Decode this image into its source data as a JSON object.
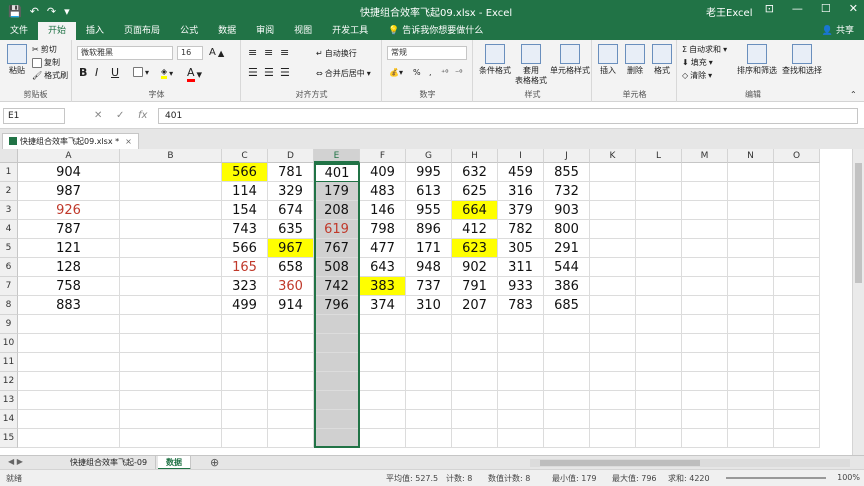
{
  "titlebar": {
    "doc_title": "快捷组合效率飞起09.xlsx  -  Excel",
    "user": "老王Excel",
    "win_min": "—",
    "win_max": "☐",
    "win_close": "✕",
    "restore": "⊡"
  },
  "tabs": {
    "items": [
      "文件",
      "开始",
      "插入",
      "页面布局",
      "公式",
      "数据",
      "审阅",
      "视图",
      "开发工具"
    ],
    "active": "开始",
    "tell_me": "告诉我你想要做什么",
    "share": "共享"
  },
  "ribbon": {
    "clipboard": {
      "label": "剪贴板",
      "paste": "粘贴",
      "cut": "剪切",
      "copy": "复制",
      "format_painter": "格式刷"
    },
    "font": {
      "label": "字体",
      "font_name": "微软雅黑",
      "font_size": "16",
      "bold": "B",
      "italic": "I",
      "underline": "U"
    },
    "alignment": {
      "label": "对齐方式",
      "wrap": "自动换行",
      "merge": "合并后居中"
    },
    "number": {
      "label": "数字",
      "format": "常规"
    },
    "styles": {
      "label": "样式",
      "conditional": "条件格式",
      "table": "套用\n表格格式",
      "cell_styles": "单元格样式"
    },
    "cells": {
      "label": "单元格",
      "insert": "插入",
      "delete": "删除",
      "format": "格式"
    },
    "editing": {
      "label": "编辑",
      "autosum": "自动求和",
      "fill": "填充",
      "clear": "清除",
      "sort": "排序和筛选",
      "find": "查找和选择"
    }
  },
  "formula_bar": {
    "name_box": "E1",
    "cancel": "✕",
    "enter": "✓",
    "fx": "fx",
    "value": "401"
  },
  "workbook_tab": {
    "name": "快捷组合效率飞起09.xlsx *",
    "close": "×"
  },
  "grid": {
    "columns": [
      "A",
      "B",
      "C",
      "D",
      "E",
      "F",
      "G",
      "H",
      "I",
      "J",
      "K",
      "L",
      "M",
      "N",
      "O"
    ],
    "rows": [
      "1",
      "2",
      "3",
      "4",
      "5",
      "6",
      "7",
      "8",
      "9",
      "10",
      "11",
      "12",
      "13",
      "14",
      "15"
    ],
    "selected_column": "E",
    "data": [
      [
        "904",
        "",
        "566",
        "781",
        "401",
        "409",
        "995",
        "632",
        "459",
        "855"
      ],
      [
        "987",
        "",
        "114",
        "329",
        "179",
        "483",
        "613",
        "625",
        "316",
        "732"
      ],
      [
        "926",
        "",
        "154",
        "674",
        "208",
        "146",
        "955",
        "664",
        "379",
        "903"
      ],
      [
        "787",
        "",
        "743",
        "635",
        "619",
        "798",
        "896",
        "412",
        "782",
        "800"
      ],
      [
        "121",
        "",
        "566",
        "967",
        "767",
        "477",
        "171",
        "623",
        "305",
        "291"
      ],
      [
        "128",
        "",
        "165",
        "658",
        "508",
        "643",
        "948",
        "902",
        "311",
        "544"
      ],
      [
        "758",
        "",
        "323",
        "360",
        "742",
        "383",
        "737",
        "791",
        "933",
        "386"
      ],
      [
        "883",
        "",
        "499",
        "914",
        "796",
        "374",
        "310",
        "207",
        "783",
        "685"
      ]
    ],
    "highlight_yellow": [
      [
        0,
        2
      ],
      [
        1,
        4
      ],
      [
        2,
        7
      ],
      [
        4,
        3
      ],
      [
        4,
        7
      ],
      [
        6,
        5
      ]
    ],
    "red_text": [
      [
        2,
        0
      ],
      [
        3,
        4
      ],
      [
        5,
        2
      ],
      [
        6,
        3
      ]
    ],
    "colors": {
      "yellow": "#ffff00",
      "red": "#c0392b",
      "accent": "#217346",
      "selected": "#d0d0d0"
    }
  },
  "sheets": {
    "tabs": [
      "快捷组合效率飞起-09",
      "数据"
    ],
    "active": "数据",
    "add": "⊕"
  },
  "status": {
    "ready": "就绪",
    "average": "平均值: 527.5",
    "count": "计数: 8",
    "numeric_count": "数值计数: 8",
    "min": "最小值: 179",
    "max": "最大值: 796",
    "sum": "求和: 4220",
    "zoom": "100%"
  }
}
